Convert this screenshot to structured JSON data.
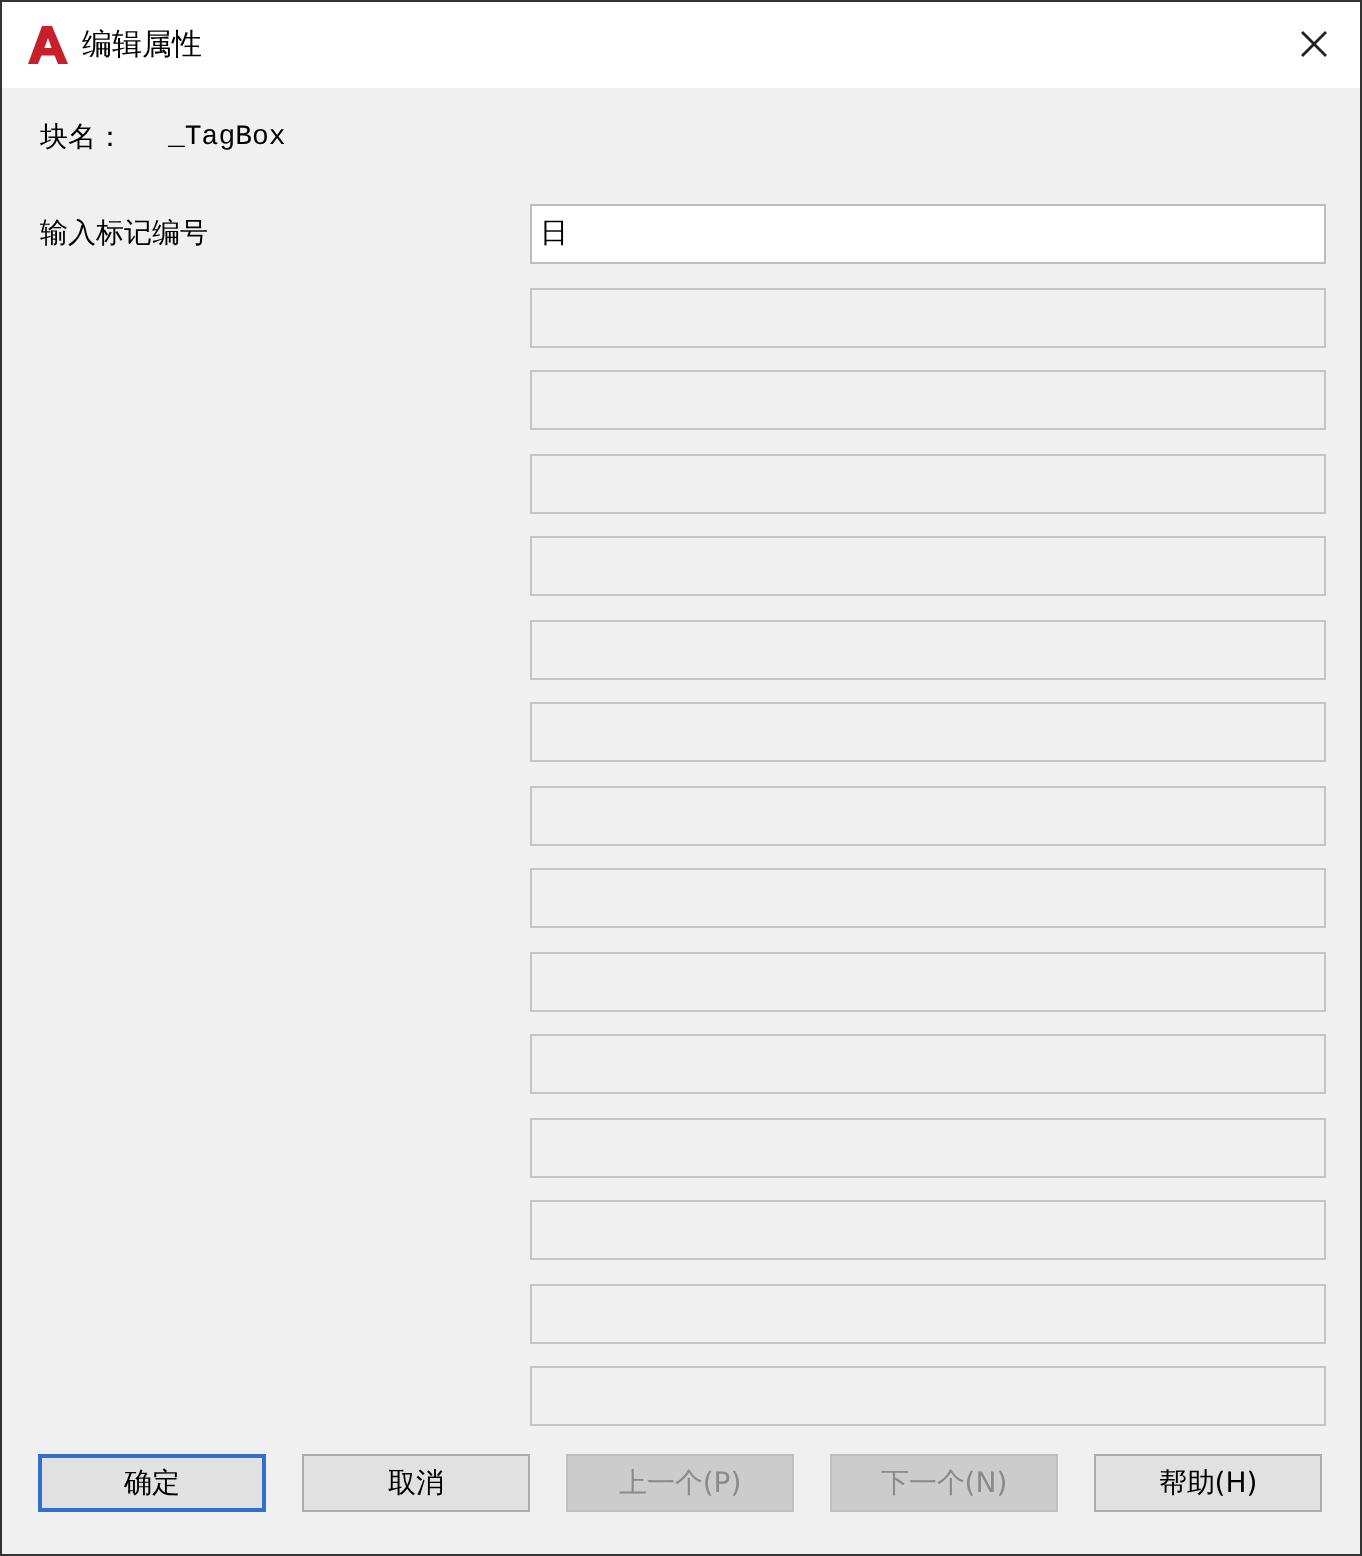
{
  "window": {
    "title": "编辑属性"
  },
  "block_name": {
    "label": "块名：",
    "value": "_TagBox"
  },
  "attribute": {
    "label": "输入标记编号"
  },
  "fields": [
    {
      "value": "日",
      "disabled": false
    },
    {
      "disabled": true
    },
    {
      "disabled": true
    },
    {
      "disabled": true
    },
    {
      "disabled": true
    },
    {
      "disabled": true
    },
    {
      "disabled": true
    },
    {
      "disabled": true
    },
    {
      "disabled": true
    },
    {
      "disabled": true
    },
    {
      "disabled": true
    },
    {
      "disabled": true
    },
    {
      "disabled": true
    },
    {
      "disabled": true
    },
    {
      "disabled": true
    }
  ],
  "buttons": [
    {
      "label": "确定",
      "disabled": false,
      "default": true
    },
    {
      "label": "取消",
      "disabled": false,
      "default": false
    },
    {
      "label": "上一个(P)",
      "disabled": true,
      "default": false
    },
    {
      "label": "下一个(N)",
      "disabled": true,
      "default": false
    },
    {
      "label": "帮助(H)",
      "disabled": false,
      "default": false
    }
  ]
}
